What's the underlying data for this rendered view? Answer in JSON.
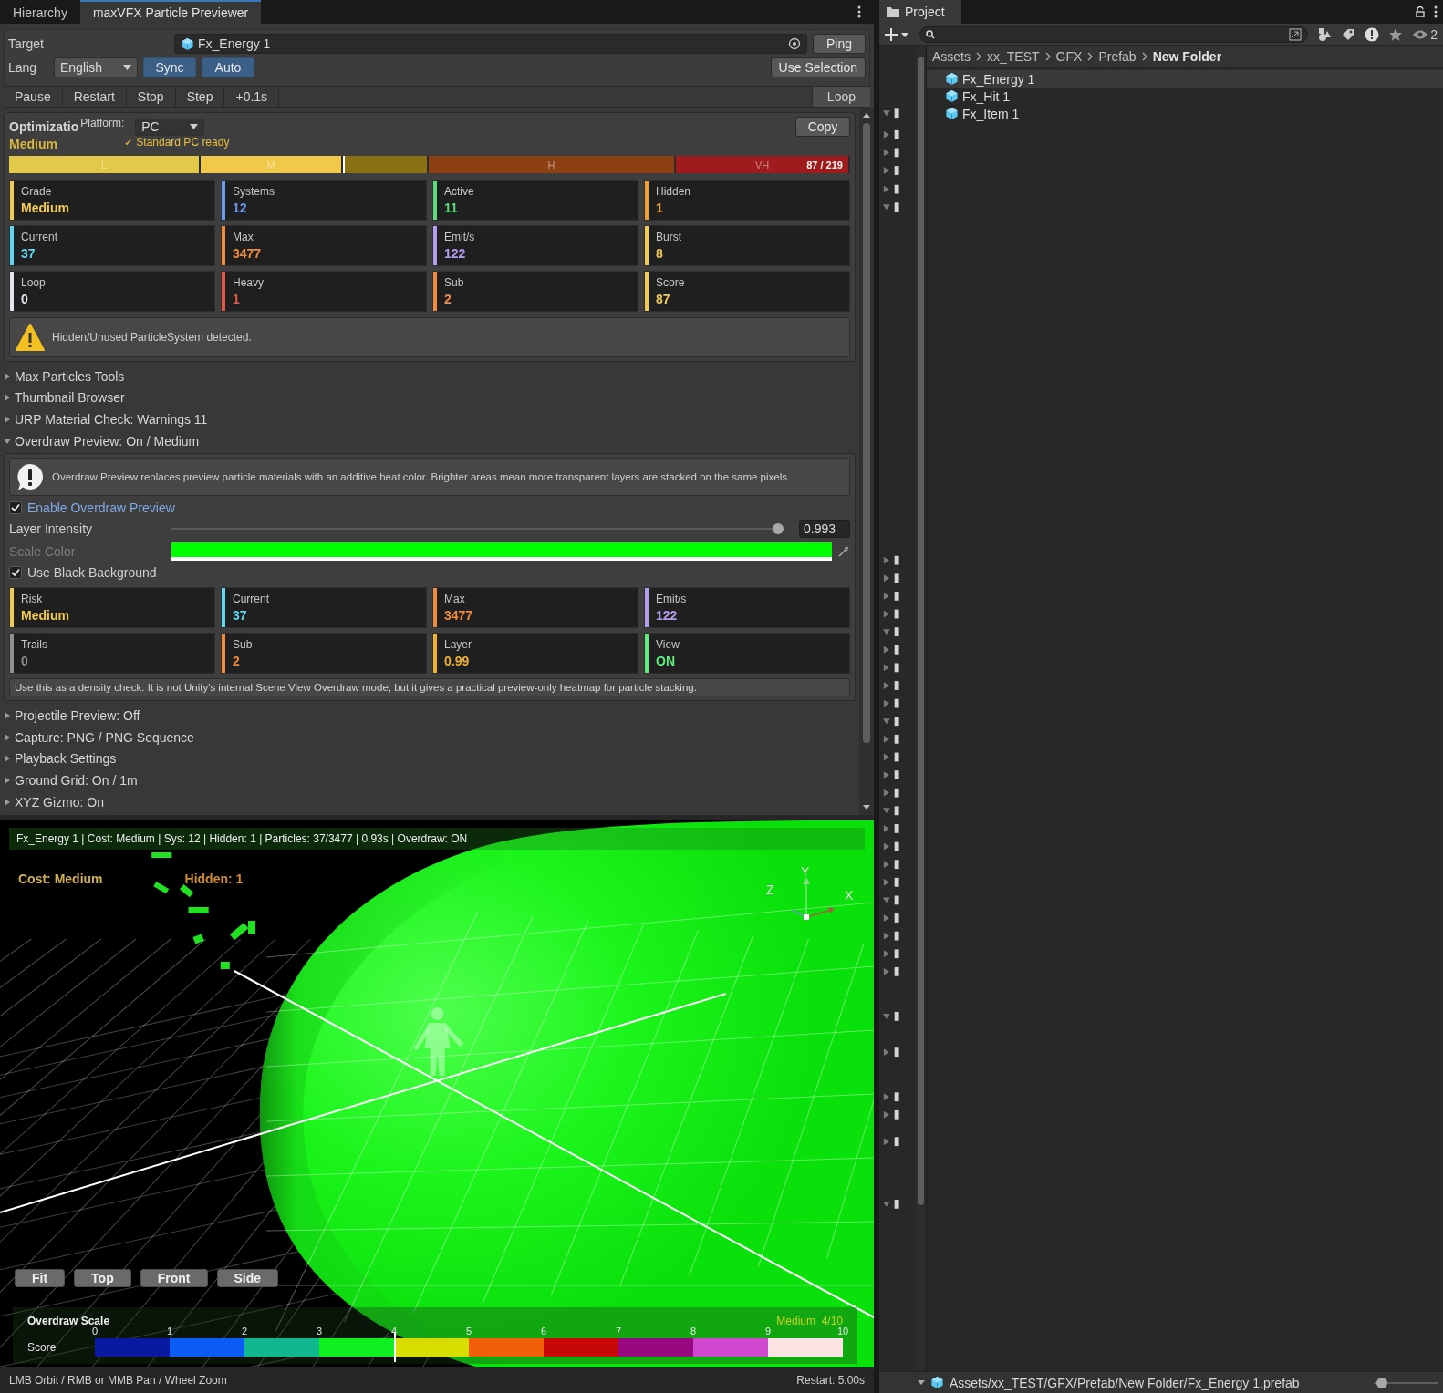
{
  "editor_tabs": [
    {
      "label": "Hierarchy",
      "selected": false
    },
    {
      "label": "maxVFX Particle Previewer",
      "selected": true
    }
  ],
  "target": {
    "label": "Target",
    "value": "Fx_Energy 1",
    "ping": "Ping"
  },
  "lang": {
    "label": "Lang",
    "value": "English",
    "toggles": [
      {
        "label": "Sync",
        "on": true
      },
      {
        "label": "Auto",
        "on": true
      }
    ],
    "use_selection": "Use Selection"
  },
  "playback": {
    "buttons": [
      "Pause",
      "Restart",
      "Stop",
      "Step",
      "+0.1s"
    ],
    "loop": {
      "label": "Loop",
      "on": true
    }
  },
  "optimization": {
    "title": "Optimizatio",
    "platform_label": "Platform:",
    "platform": "PC",
    "copy": "Copy",
    "grade": "Medium",
    "status": "✓ Standard PC ready",
    "quality_bar": {
      "score": "87 / 219",
      "level": 0.397,
      "segments": [
        {
          "label": "L",
          "color": "#e3c94a"
        },
        {
          "label": "M",
          "color": "#f0c84a"
        },
        {
          "color": "#8a7214"
        },
        {
          "label": "H",
          "color": "#8c4012"
        },
        {
          "label": "VH",
          "color": "#a01c1c"
        }
      ]
    },
    "stats": [
      {
        "label": "Grade",
        "value": "Medium",
        "color": "#f2cc50"
      },
      {
        "label": "Systems",
        "value": "12",
        "color": "#6c9cf0"
      },
      {
        "label": "Active",
        "value": "11",
        "color": "#5cdc7c"
      },
      {
        "label": "Hidden",
        "value": "1",
        "color": "#f0a030"
      },
      {
        "label": "Current",
        "value": "37",
        "color": "#5cd8f0"
      },
      {
        "label": "Max",
        "value": "3477",
        "color": "#f08c3c"
      },
      {
        "label": "Emit/s",
        "value": "122",
        "color": "#b49cf0"
      },
      {
        "label": "Burst",
        "value": "8",
        "color": "#f2cc50"
      },
      {
        "label": "Loop",
        "value": "0",
        "color": "#e4e4f0"
      },
      {
        "label": "Heavy",
        "value": "1",
        "color": "#e85848"
      },
      {
        "label": "Sub",
        "value": "2",
        "color": "#f08c3c"
      },
      {
        "label": "Score",
        "value": "87",
        "color": "#f2cc50"
      }
    ],
    "warning": "Hidden/Unused ParticleSystem detected."
  },
  "sections": [
    {
      "label": "Max Particles Tools",
      "expanded": false,
      "kind": "plain"
    },
    {
      "label": "Thumbnail Browser",
      "expanded": false,
      "kind": "plain"
    },
    {
      "label": "URP Material Check: Warnings 11",
      "expanded": false,
      "kind": "plain"
    },
    {
      "label": "Overdraw Preview: On / Medium",
      "expanded": true,
      "kind": "overdraw"
    },
    {
      "label": "Projectile Preview: Off",
      "expanded": false,
      "kind": "plain"
    },
    {
      "label": "Capture: PNG / PNG Sequence",
      "expanded": false,
      "kind": "plain"
    },
    {
      "label": "Playback Settings",
      "expanded": false,
      "kind": "plain"
    },
    {
      "label": "Ground Grid: On / 1m",
      "expanded": false,
      "kind": "plain"
    },
    {
      "label": "XYZ Gizmo: On",
      "expanded": false,
      "kind": "plain"
    }
  ],
  "overdraw": {
    "info": "Overdraw Preview replaces preview particle materials with an additive heat color. Brighter areas mean more transparent layers are stacked on the same pixels.",
    "enable": {
      "label": "Enable Overdraw Preview",
      "checked": true
    },
    "intensity": {
      "label": "Layer Intensity",
      "level": 0.99,
      "value": "0.993"
    },
    "scale_color": {
      "label": "Scale Color",
      "color": "#00ff00",
      "disabled": true
    },
    "black_background": {
      "label": "Use Black Background",
      "checked": true
    },
    "stats": [
      {
        "label": "Risk",
        "value": "Medium",
        "color": "#f2cc50"
      },
      {
        "label": "Current",
        "value": "37",
        "color": "#5cd8f0"
      },
      {
        "label": "Max",
        "value": "3477",
        "color": "#f08c3c"
      },
      {
        "label": "Emit/s",
        "value": "122",
        "color": "#b49cf0"
      },
      {
        "label": "Trails",
        "value": "0",
        "color": "#909090"
      },
      {
        "label": "Sub",
        "value": "2",
        "color": "#f08c3c"
      },
      {
        "label": "Layer",
        "value": "0.99",
        "color": "#f2b030"
      },
      {
        "label": "View",
        "value": "ON",
        "color": "#5cf07c"
      }
    ],
    "note": "Use this as a density check. It is not Unity's internal Scene View Overdraw mode, but it gives a practical preview-only heatmap for particle stacking."
  },
  "viewport": {
    "info": "Fx_Energy 1 | Cost: Medium | Sys: 12 | Hidden: 1 | Particles: 37/3477 | 0.93s | Overdraw: ON",
    "cost": "Cost: Medium",
    "hidden": "Hidden: 1",
    "axes": [
      "Y",
      "Z",
      "X"
    ],
    "view_buttons": [
      "Fit",
      "Top",
      "Front",
      "Side"
    ],
    "scale": {
      "title": "Overdraw Scale",
      "row_label": "Score",
      "grade": "Medium",
      "grade_score": "4/10",
      "level": 0.4,
      "ticks": [
        "0",
        "1",
        "2",
        "3",
        "4",
        "5",
        "6",
        "7",
        "8",
        "9",
        "10"
      ],
      "segments": [
        {
          "color": "#0a1aa0"
        },
        {
          "color": "#0a5cf5"
        },
        {
          "color": "#10b890"
        },
        {
          "color": "#10f020"
        },
        {
          "color": "#d8dc00"
        },
        {
          "color": "#f06008"
        },
        {
          "color": "#c80808"
        },
        {
          "color": "#980880"
        },
        {
          "color": "#d048d0"
        },
        {
          "color": "#fde4e4"
        }
      ]
    }
  },
  "status_bar": {
    "hint": "LMB Orbit / RMB or MMB Pan / Wheel Zoom",
    "restart": "Restart: 5.00s"
  },
  "project": {
    "tab": "Project",
    "count": "2",
    "breadcrumb": [
      "Assets",
      "xx_TEST",
      "GFX",
      "Prefab",
      "New Folder"
    ],
    "files": [
      {
        "name": "Fx_Energy 1",
        "selected": true
      },
      {
        "name": "Fx_Hit 1",
        "selected": false
      },
      {
        "name": "Fx_Item 1",
        "selected": false
      }
    ],
    "path": "Assets/xx_TEST/GFX/Prefab/New Folder/Fx_Energy 1.prefab",
    "icon_size": {
      "level": 0.05
    }
  }
}
